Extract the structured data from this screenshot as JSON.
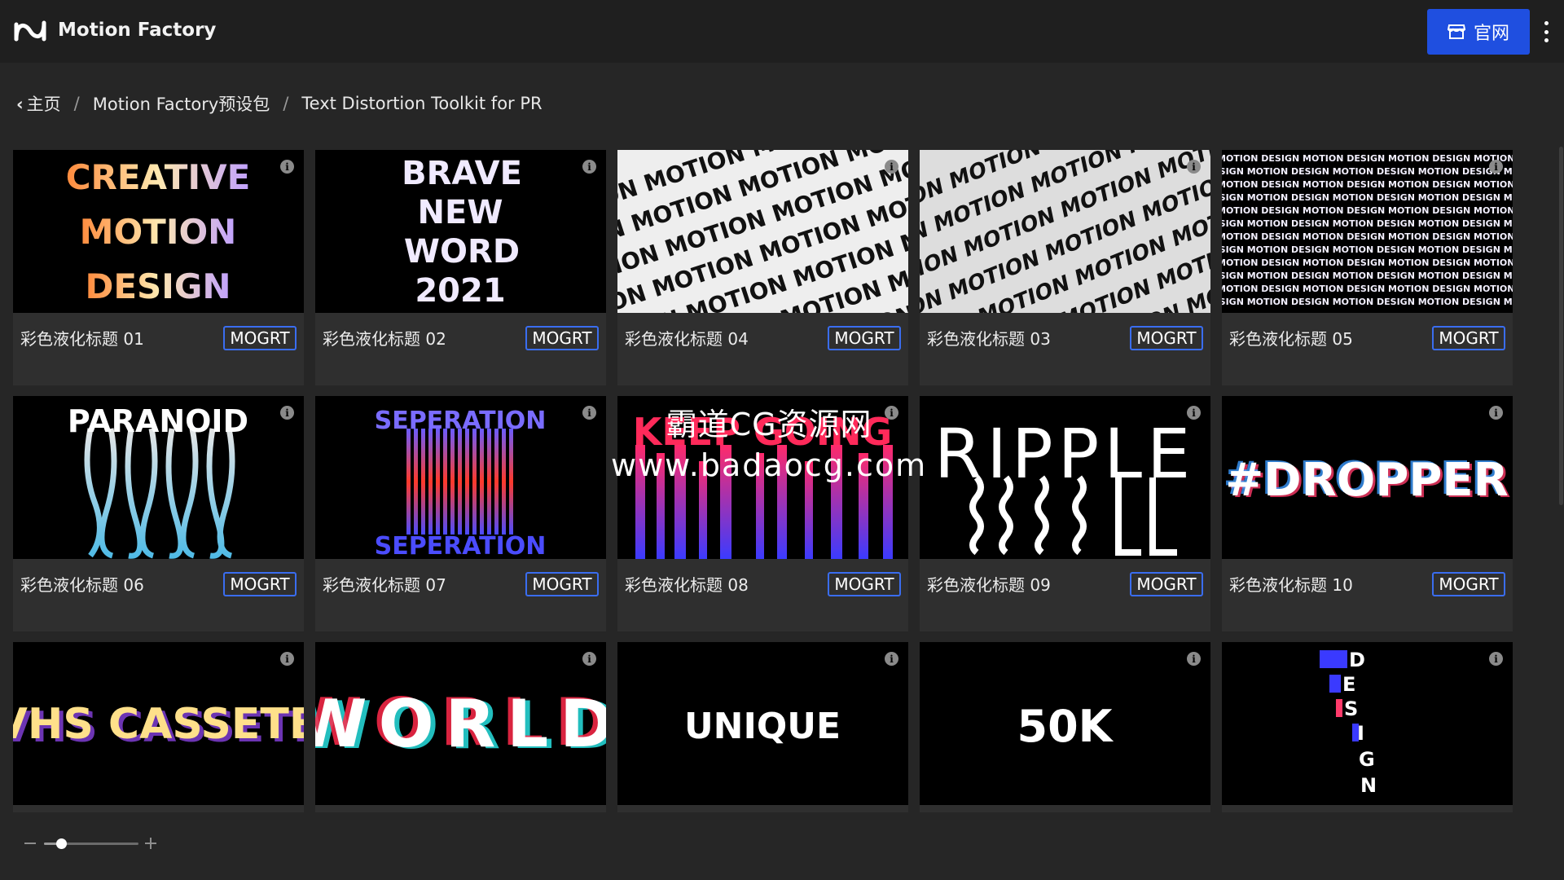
{
  "app": {
    "title": "Motion Factory"
  },
  "header": {
    "site_button_label": "官网"
  },
  "breadcrumb": {
    "home": "主页",
    "pack": "Motion Factory预设包",
    "current": "Text Distortion Toolkit for PR",
    "separator": "/"
  },
  "cards": [
    {
      "title": "彩色液化标题 01",
      "badge": "MOGRT",
      "preview_text": "CREATIVE MOTION DESIGN"
    },
    {
      "title": "彩色液化标题 02",
      "badge": "MOGRT",
      "preview_text": "BRAVE NEW WORD 2021"
    },
    {
      "title": "彩色液化标题 04",
      "badge": "MOGRT",
      "preview_text": "MOTION"
    },
    {
      "title": "彩色液化标题 03",
      "badge": "MOGRT",
      "preview_text": "MOTION"
    },
    {
      "title": "彩色液化标题 05",
      "badge": "MOGRT",
      "preview_text": "MOTION DESIGN"
    },
    {
      "title": "彩色液化标题 06",
      "badge": "MOGRT",
      "preview_text": "PARANOID"
    },
    {
      "title": "彩色液化标题 07",
      "badge": "MOGRT",
      "preview_text": "SEPERATION"
    },
    {
      "title": "彩色液化标题 08",
      "badge": "MOGRT",
      "preview_text": "KEEP GOING"
    },
    {
      "title": "彩色液化标题 09",
      "badge": "MOGRT",
      "preview_text": "RIPPLE"
    },
    {
      "title": "彩色液化标题 10",
      "badge": "MOGRT",
      "preview_text": "#DROPPER"
    },
    {
      "title": "",
      "badge": "",
      "preview_text": "VHS CASSETE"
    },
    {
      "title": "",
      "badge": "",
      "preview_text": "WORLD"
    },
    {
      "title": "",
      "badge": "",
      "preview_text": "UNIQUE"
    },
    {
      "title": "",
      "badge": "",
      "preview_text": "50K"
    },
    {
      "title": "",
      "badge": "",
      "preview_text": "DESIGN"
    }
  ],
  "watermark": {
    "line1": "霸道CG资源网",
    "line2": "www.badaocg.com"
  },
  "zoom": {
    "level": 0.18
  }
}
